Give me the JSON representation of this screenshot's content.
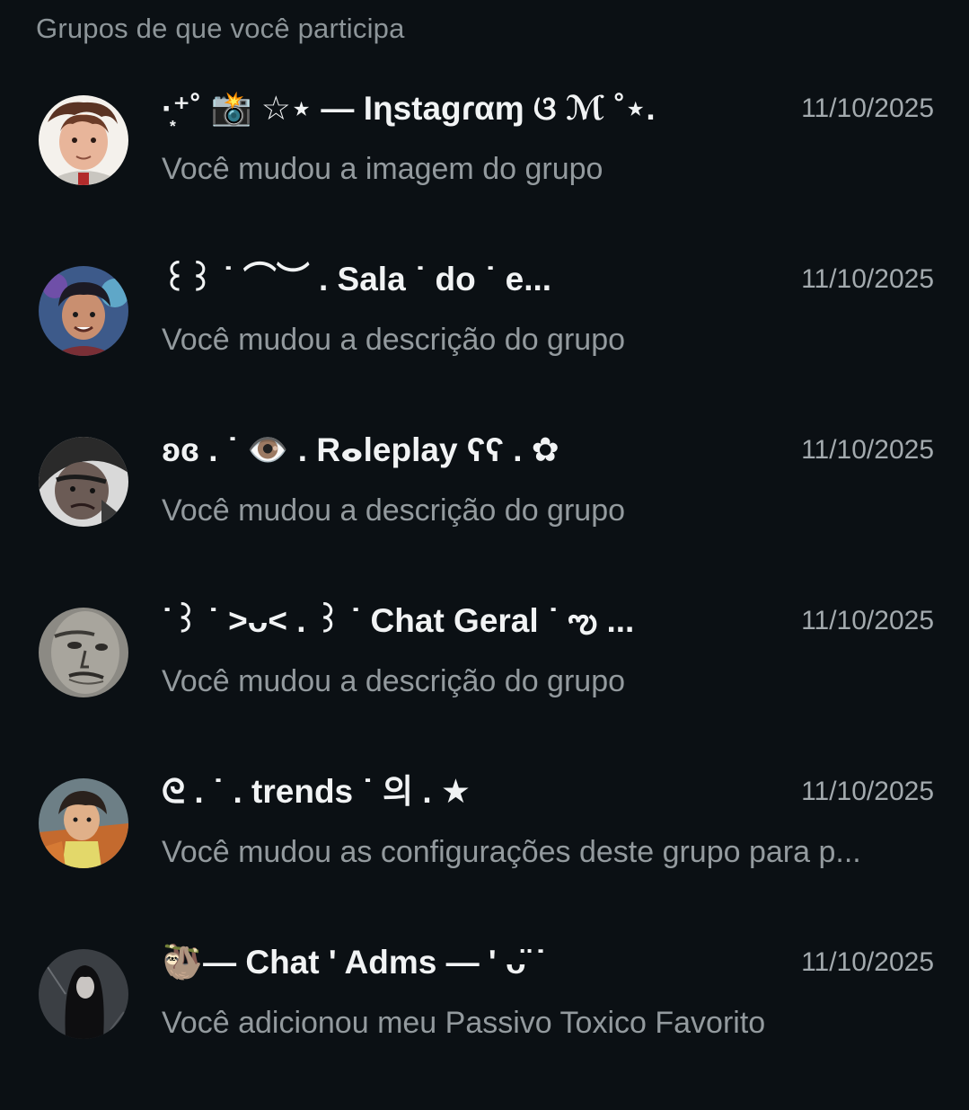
{
  "section_title": "Grupos de que você participa",
  "groups": [
    {
      "avatar_icon": "avatar-curly-hair-illustration",
      "name": "·͙⁺˚ 📸 ☆⋆ — Iɳstagɾαɱ ଓ ℳ ˚⋆.",
      "date": "11/10/2025",
      "preview": "Você mudou a imagem do grupo"
    },
    {
      "avatar_icon": "avatar-anime-boy",
      "name": "꒰꒱ ˙ ⌒︶ . Sala ˙ do ˙ e...",
      "date": "11/10/2025",
      "preview": "Você mudou a descrição do grupo"
    },
    {
      "avatar_icon": "avatar-dark-manga-face",
      "name": "ʚɞ . ˙ 👁️ . Rⴰleplay ʕʕ . ✿",
      "date": "11/10/2025",
      "preview": "Você mudou a descrição do grupo"
    },
    {
      "avatar_icon": "avatar-grey-face",
      "name": "˙꒱ ˙ >ᴗ< . ꒱ ˙ Chat Geral ˙ ఌ ...",
      "date": "11/10/2025",
      "preview": "Você mudou a descrição do grupo"
    },
    {
      "avatar_icon": "avatar-orange-anime",
      "name": "ᘓ . ˙ . trends ˙ 의 . ★",
      "date": "11/10/2025",
      "preview": "Você mudou as configurações deste grupo para p..."
    },
    {
      "avatar_icon": "avatar-dark-figure",
      "name": "🦥— Chat ' Adms — ' ᴗ̈ ˙",
      "date": "11/10/2025",
      "preview": "Você adicionou meu Passivo Toxico Favorito"
    }
  ]
}
